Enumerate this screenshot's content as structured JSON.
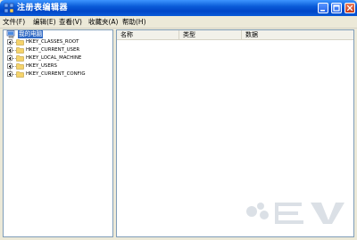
{
  "window": {
    "title": "注册表编辑器",
    "controls": [
      "minimize-icon",
      "maximize-icon",
      "close-icon"
    ]
  },
  "menu": [
    "文件(F)",
    "编辑(E)",
    "查看(V)",
    "收藏夹(A)",
    "帮助(H)"
  ],
  "tree": {
    "root": "我的电脑",
    "nodes": [
      "HKEY_CLASSES_ROOT",
      "HKEY_CURRENT_USER",
      "HKEY_LOCAL_MACHINE",
      "HKEY_USERS",
      "HKEY_CURRENT_CONFIG"
    ]
  },
  "columns": [
    "名称",
    "类型",
    "数据"
  ],
  "colors": {
    "titlebar": "#0a5bd8",
    "selection": "#316ac5",
    "folder": "#f5d36b"
  }
}
